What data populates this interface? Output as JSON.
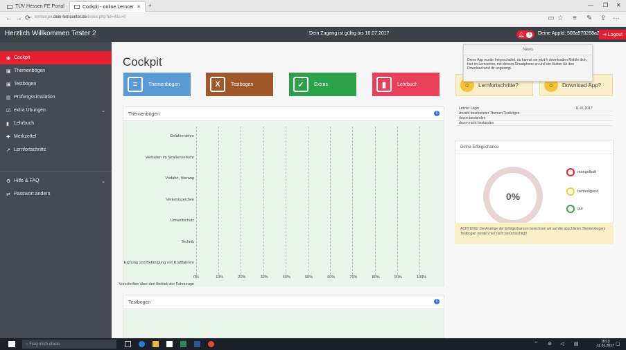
{
  "browser": {
    "tab1": "TÜV Hessen FE Portal",
    "tab2": "Cockpit - online Lerncer",
    "tab_close": "✕",
    "tab_plus": "+",
    "url_prefix": "emberger.",
    "url_host": "dein-lerncenter.de",
    "url_path": "/index.php?id=4&c=0",
    "back": "←",
    "forward": "→",
    "refresh": "⟳",
    "win_min": "—",
    "win_max": "❐",
    "win_close": "✕",
    "tool_reader": "▭",
    "tool_star": "☆",
    "tool_menu": "≡",
    "tool_note": "✎",
    "tool_share": "⇪",
    "tool_more": "···"
  },
  "header": {
    "welcome": "Herzlich Willkommen Tester 2",
    "valid_until": "Dein Zugang ist gültig bis 10.07.2017",
    "bell_count": "1",
    "app_id": "Deine AppId: 508a970268a2",
    "logout": "Logout"
  },
  "sidebar": {
    "items": [
      {
        "icon": "◉",
        "label": "Cockpit",
        "active": true
      },
      {
        "icon": "▣",
        "label": "Themenbögen"
      },
      {
        "icon": "▣",
        "label": "Testbögen"
      },
      {
        "icon": "▥",
        "label": "Prüfungssimulation"
      },
      {
        "icon": "☑",
        "label": "extra Übungen",
        "chevron": "⌄"
      },
      {
        "icon": "▮",
        "label": "Lehrbuch"
      },
      {
        "icon": "✚",
        "label": "Merkzettel"
      },
      {
        "icon": "↗",
        "label": "Lernfortschritte"
      },
      {
        "icon": "⚙",
        "label": "Hilfe & FAQ",
        "chevron": "⌄"
      },
      {
        "icon": "⇄",
        "label": "Passwort ändern"
      }
    ]
  },
  "main": {
    "title": "Cockpit",
    "tiles": [
      {
        "label": "Themenbogen",
        "glyph": "≡",
        "color": "#5a9bd5"
      },
      {
        "label": "Testbogen",
        "glyph": "X",
        "color": "#a0582a"
      },
      {
        "label": "Extras",
        "glyph": "✓",
        "color": "#2da04a"
      },
      {
        "label": "Lehrbuch",
        "glyph": "▮",
        "color": "#e8405a"
      }
    ],
    "panel1_title": "Themenbögen",
    "panel2_title": "Testbogen",
    "info": "i"
  },
  "chart_data": {
    "type": "bar",
    "orientation": "horizontal",
    "categories": [
      "Gefahrenlehre",
      "Verhalten im Straßenverkehr",
      "Vorfahrt, Vorrang",
      "Verkehrszeichen",
      "Umweltschutz",
      "Technik",
      "Eignung und Befähigung von Kraftfahrern",
      "Vorschriften über den Betrieb der Fahrzeuge"
    ],
    "values": [
      0,
      0,
      0,
      0,
      0,
      0,
      0,
      0
    ],
    "xlim": [
      0,
      100
    ],
    "ticks": [
      "0%",
      "10%",
      "20%",
      "30%",
      "40%",
      "50%",
      "60%",
      "70%",
      "80%",
      "90%",
      "100%"
    ],
    "grid": true
  },
  "news": {
    "title": "News",
    "text": "Deine App wurde freigeschaltet, du kannst sie jetzt fr downloaden Mobile dich, hier im Lerncenter, mit deinem Smartphone an und der Button für den Download wird dir angezeigt."
  },
  "cta": {
    "left": "Lernfortschritte?",
    "right": "Download App?",
    "face": "☺"
  },
  "stats": {
    "rows": [
      {
        "label": "Letzter Login",
        "value": "11.01.2017"
      },
      {
        "label": "Anzahl bearbeiteter Themen/Testbögen",
        "value": ""
      },
      {
        "label": "davon bestanden",
        "value": ""
      },
      {
        "label": "davon nicht bestanden",
        "value": ""
      }
    ]
  },
  "success": {
    "title": "Deine Erfolgschance",
    "percent": "0%",
    "progress": 0,
    "legend": [
      {
        "label": "mangelhaft",
        "color": "#e51e30"
      },
      {
        "label": "befriedigend",
        "color": "#f2d22a"
      },
      {
        "label": "gut",
        "color": "#3aa63a"
      }
    ],
    "warning": "ACHTUNG! Die Anzeige der Erfolgschancen berechnen wir auf die abschlielen Themenbogen/ Testbogen werden hier nicht berücksichtigt!"
  },
  "taskbar": {
    "search": "Frag mich etwas",
    "time": "15:13",
    "date": "11.01.2017"
  }
}
